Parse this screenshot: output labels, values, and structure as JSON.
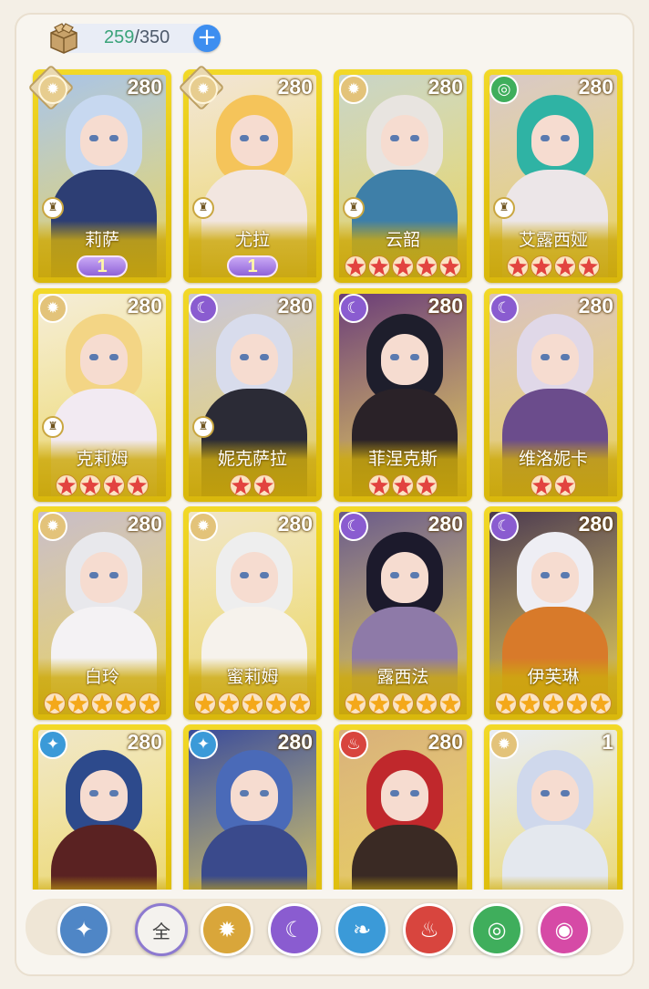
{
  "header": {
    "capacity_current": "259",
    "capacity_separator": "/",
    "capacity_max": "350",
    "add_label": "+",
    "box_icon": "gift-box-icon"
  },
  "cards": [
    {
      "name": "莉萨",
      "level": "280",
      "element": "light",
      "diamond": true,
      "rank_icon": true,
      "badge": "1",
      "stars": 0,
      "star_color": "none",
      "hair": "#c7d8f0",
      "body": "#2d3e74",
      "bg": "#a8c3e8"
    },
    {
      "name": "尤拉",
      "level": "280",
      "element": "light",
      "diamond": true,
      "rank_icon": true,
      "badge": "1",
      "stars": 0,
      "star_color": "none",
      "hair": "#f5c45a",
      "body": "#f2e6e0",
      "bg": "#f1e4d7"
    },
    {
      "name": "云韶",
      "level": "280",
      "element": "light",
      "diamond": false,
      "rank_icon": true,
      "badge": "",
      "stars": 5,
      "star_color": "red",
      "hair": "#e8e4e0",
      "body": "#3e7fa8",
      "bg": "#c8d4c8"
    },
    {
      "name": "艾露西娅",
      "level": "280",
      "element": "wind",
      "diamond": false,
      "rank_icon": true,
      "badge": "",
      "stars": 4,
      "star_color": "red",
      "hair": "#2fb3a4",
      "body": "#ece6e8",
      "bg": "#d8c8c8"
    },
    {
      "name": "克莉姆",
      "level": "280",
      "element": "light",
      "diamond": false,
      "rank_icon": true,
      "badge": "",
      "stars": 4,
      "star_color": "red",
      "hair": "#f3d585",
      "body": "#f2eaf2",
      "bg": "#f4ecd8"
    },
    {
      "name": "妮克萨拉",
      "level": "280",
      "element": "dark",
      "diamond": false,
      "rank_icon": true,
      "badge": "",
      "stars": 2,
      "star_color": "red",
      "hair": "#d8dcec",
      "body": "#2b2b36",
      "bg": "#c8c4d8"
    },
    {
      "name": "菲涅克斯",
      "level": "280",
      "element": "dark",
      "diamond": false,
      "rank_icon": false,
      "badge": "",
      "stars": 3,
      "star_color": "red",
      "hair": "#1e1e2c",
      "body": "#2a2228",
      "bg": "#6a3c78"
    },
    {
      "name": "维洛妮卡",
      "level": "280",
      "element": "dark",
      "diamond": false,
      "rank_icon": false,
      "badge": "",
      "stars": 2,
      "star_color": "red",
      "hair": "#e0d8e8",
      "body": "#6b4c8c",
      "bg": "#d8c0c0"
    },
    {
      "name": "白玲",
      "level": "280",
      "element": "light",
      "diamond": false,
      "rank_icon": false,
      "badge": "",
      "stars": 5,
      "star_color": "gold",
      "hair": "#e8e8ec",
      "body": "#f4f2f4",
      "bg": "#c8bcc8"
    },
    {
      "name": "蜜莉姆",
      "level": "280",
      "element": "light",
      "diamond": false,
      "rank_icon": false,
      "badge": "",
      "stars": 5,
      "star_color": "gold",
      "hair": "#eeeeee",
      "body": "#f6f2ec",
      "bg": "#efe4c8"
    },
    {
      "name": "露西法",
      "level": "280",
      "element": "dark",
      "diamond": false,
      "rank_icon": false,
      "badge": "",
      "stars": 5,
      "star_color": "gold",
      "hair": "#1c1a2c",
      "body": "#8e7aa8",
      "bg": "#6a5a8a"
    },
    {
      "name": "伊芙琳",
      "level": "280",
      "element": "dark",
      "diamond": false,
      "rank_icon": false,
      "badge": "",
      "stars": 5,
      "star_color": "gold",
      "hair": "#eeeef4",
      "body": "#d87a2a",
      "bg": "#4c3a50"
    },
    {
      "name": "",
      "level": "280",
      "element": "water",
      "diamond": false,
      "rank_icon": false,
      "badge": "",
      "stars": 0,
      "star_color": "none",
      "hair": "#2d4a8c",
      "body": "#5a2222",
      "bg": "#f0e6c8"
    },
    {
      "name": "",
      "level": "280",
      "element": "water",
      "diamond": false,
      "rank_icon": false,
      "badge": "",
      "stars": 0,
      "star_color": "none",
      "hair": "#4a6ab8",
      "body": "#3a4a8c",
      "bg": "#3b4c9a"
    },
    {
      "name": "",
      "level": "280",
      "element": "fire",
      "diamond": false,
      "rank_icon": false,
      "badge": "",
      "stars": 0,
      "star_color": "none",
      "hair": "#c0282c",
      "body": "#3a2a24",
      "bg": "#d8b07a"
    },
    {
      "name": "",
      "level": "1",
      "element": "light",
      "diamond": false,
      "rank_icon": false,
      "badge": "",
      "stars": 0,
      "star_color": "none",
      "hair": "#cfd8ec",
      "body": "#e4e8ee",
      "bg": "#e8ecf4"
    }
  ],
  "filters": [
    {
      "key": "rank",
      "label": "",
      "icon": "sparkle-arrow-icon",
      "color": "#4f86c6"
    },
    {
      "key": "all",
      "label": "全",
      "icon": "",
      "color": "#f4f2ee"
    },
    {
      "key": "light",
      "label": "",
      "icon": "sun-icon",
      "color": "#d9a63a"
    },
    {
      "key": "dark",
      "label": "",
      "icon": "moon-icon",
      "color": "#8a5cd0"
    },
    {
      "key": "water",
      "label": "",
      "icon": "water-drop-icon",
      "color": "#3b9ad8"
    },
    {
      "key": "fire",
      "label": "",
      "icon": "flame-icon",
      "color": "#d8453e"
    },
    {
      "key": "wind",
      "label": "",
      "icon": "whirlwind-icon",
      "color": "#3fae5c"
    },
    {
      "key": "arcane",
      "label": "",
      "icon": "orb-icon",
      "color": "#d64aa6"
    }
  ],
  "element_colors": {
    "light": "#e3c37a",
    "dark": "#8a5cd0",
    "water": "#3b9ad8",
    "fire": "#d8453e",
    "wind": "#3fae5c"
  }
}
